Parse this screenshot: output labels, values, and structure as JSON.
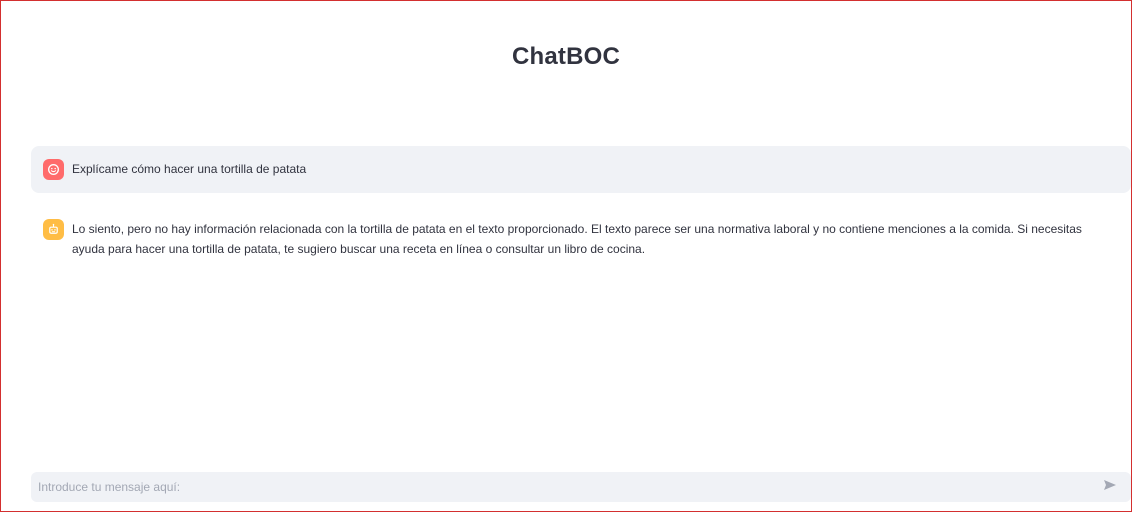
{
  "app": {
    "title": "ChatBOC"
  },
  "messages": [
    {
      "role": "user",
      "avatar_icon": "smiley-face-icon",
      "avatar_color": "#ff6b6b",
      "text": "Explícame cómo hacer una tortilla de patata"
    },
    {
      "role": "assistant",
      "avatar_icon": "robot-icon",
      "avatar_color": "#ffbd45",
      "text": "Lo siento, pero no hay información relacionada con la tortilla de patata en el texto proporcionado. El texto parece ser una normativa laboral y no contiene menciones a la comida. Si necesitas ayuda para hacer una tortilla de patata, te sugiero buscar una receta en línea o consultar un libro de cocina."
    }
  ],
  "chat_input": {
    "value": "",
    "placeholder": "Introduce tu mensaje aquí:",
    "send_icon": "send-icon"
  },
  "colors": {
    "frame_border": "#d32f2f",
    "user_bubble_bg": "#f0f2f6",
    "input_bg": "#f0f2f6",
    "text": "#31333f"
  }
}
